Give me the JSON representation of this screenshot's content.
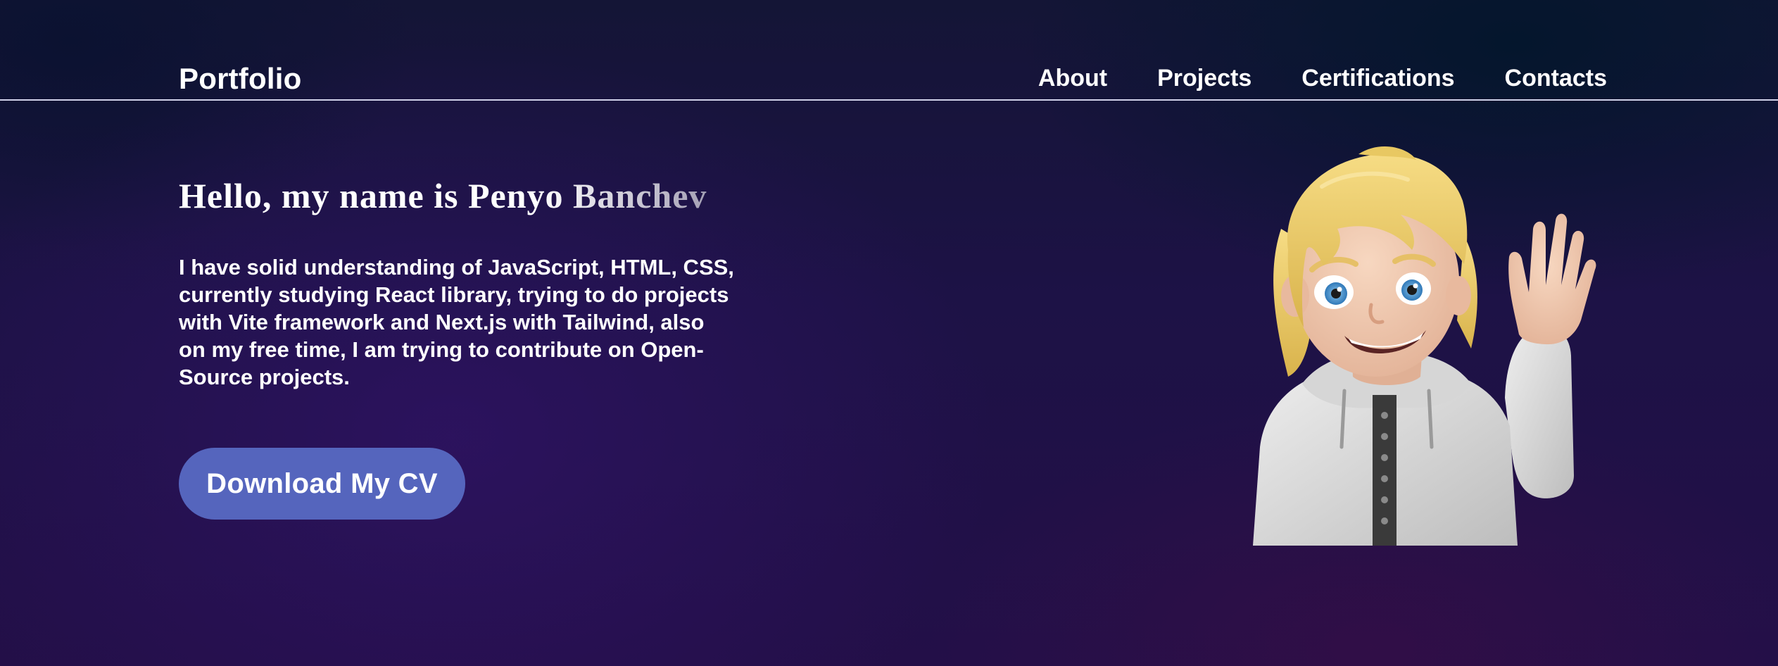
{
  "header": {
    "brand": "Portfolio",
    "nav": [
      {
        "label": "About"
      },
      {
        "label": "Projects"
      },
      {
        "label": "Certifications"
      },
      {
        "label": "Contacts"
      }
    ]
  },
  "hero": {
    "title": "Hello, my name is Penyo Banchev",
    "description": "I have solid understanding of JavaScript, HTML, CSS, currently studying React library, trying to do projects with Vite framework and Next.js with Tailwind, also on my free time, I am trying to contribute on Open-Source projects.",
    "cv_button_label": "Download My CV",
    "avatar_icon": "waving-avatar-icon"
  },
  "colors": {
    "button": "#5565bd",
    "divider": "#cfd0e8",
    "background_dark": "#0a1330",
    "background_purple": "#23104a"
  }
}
